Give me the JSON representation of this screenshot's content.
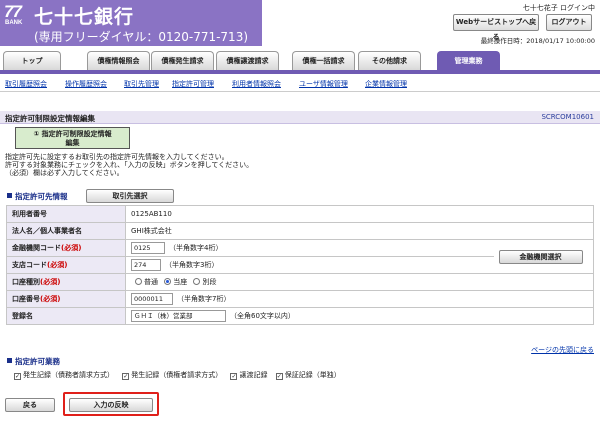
{
  "header": {
    "logo_number": "77",
    "logo_sub": "BANK",
    "bank_name": "七十七銀行",
    "phone": "(専用フリーダイヤル：0120-771-713)",
    "user_status": "七十七花子 ログイン中",
    "web_service_top_label": "Webサービストップへ戻る",
    "logout_label": "ログアウト",
    "last_operation": "最終操作日時：2018/01/17 10:00:00"
  },
  "nav": {
    "tabs": [
      "トップ",
      "債権情報照会",
      "債権発生請求",
      "債権譲渡請求",
      "債権一括請求",
      "その他請求",
      "管理業務"
    ],
    "active_tab": "管理業務"
  },
  "subnav": {
    "links": [
      "取引履歴照会",
      "操作履歴照会",
      "取引先管理",
      "指定許可管理",
      "利用者情報照会",
      "ユーザ情報管理",
      "企業情報管理"
    ]
  },
  "page": {
    "title": "指定許可制限設定情報編集",
    "screen_code": "SCRCOM10601",
    "step_label": "① 指定許可制限設定情報\n編集",
    "instructions": [
      "指定許可先に設定するお取引先の指定許可先情報を入力してください。",
      "許可する対象業務にチェックを入れ、「入力の反映」ボタンを押してください。",
      "（必須）欄は必ず入力してください。"
    ],
    "required_mark": "(必須)"
  },
  "section1": {
    "heading": "指定許可先情報",
    "select_partner_button": "取引先選択",
    "bank_search_button": "金融機関選択",
    "rows": {
      "user_number": {
        "label": "利用者番号",
        "value": "0125AB110"
      },
      "corp_name": {
        "label": "法人名／個人事業者名",
        "value": "GHI株式会社"
      },
      "bank_code": {
        "label": "金融機関コード",
        "required": "(必須)",
        "value": "0125",
        "hint": "（半角数字4桁）"
      },
      "branch_code": {
        "label": "支店コード",
        "required": "(必須)",
        "value": "274",
        "hint": "（半角数字3桁）"
      },
      "account_type": {
        "label": "口座種別",
        "required": "(必須)",
        "options": [
          "普通",
          "当座",
          "別段"
        ],
        "selected": "当座"
      },
      "account_number": {
        "label": "口座番号",
        "required": "(必須)",
        "value": "0000011",
        "hint": "（半角数字7桁）"
      },
      "registered_name": {
        "label": "登録名",
        "value": "ＧＨＩ（株）営業部",
        "hint": "（全角60文字以内）"
      }
    }
  },
  "page_top_link": "ページの先頭に戻る",
  "section2": {
    "heading": "指定許可業務",
    "checks": [
      {
        "label": "発生記録（債務者請求方式）",
        "checked": true
      },
      {
        "label": "発生記録（債権者請求方式）",
        "checked": true
      },
      {
        "label": "譲渡記録",
        "checked": true
      },
      {
        "label": "保証記録（単独）",
        "checked": true
      }
    ]
  },
  "footer": {
    "back_label": "戻る",
    "apply_label": "入力の反映"
  },
  "colors": {
    "brand": "#8a73c4",
    "nav_active": "#6f5bb3",
    "required": "#cc0000",
    "highlight": "#e0201a"
  }
}
